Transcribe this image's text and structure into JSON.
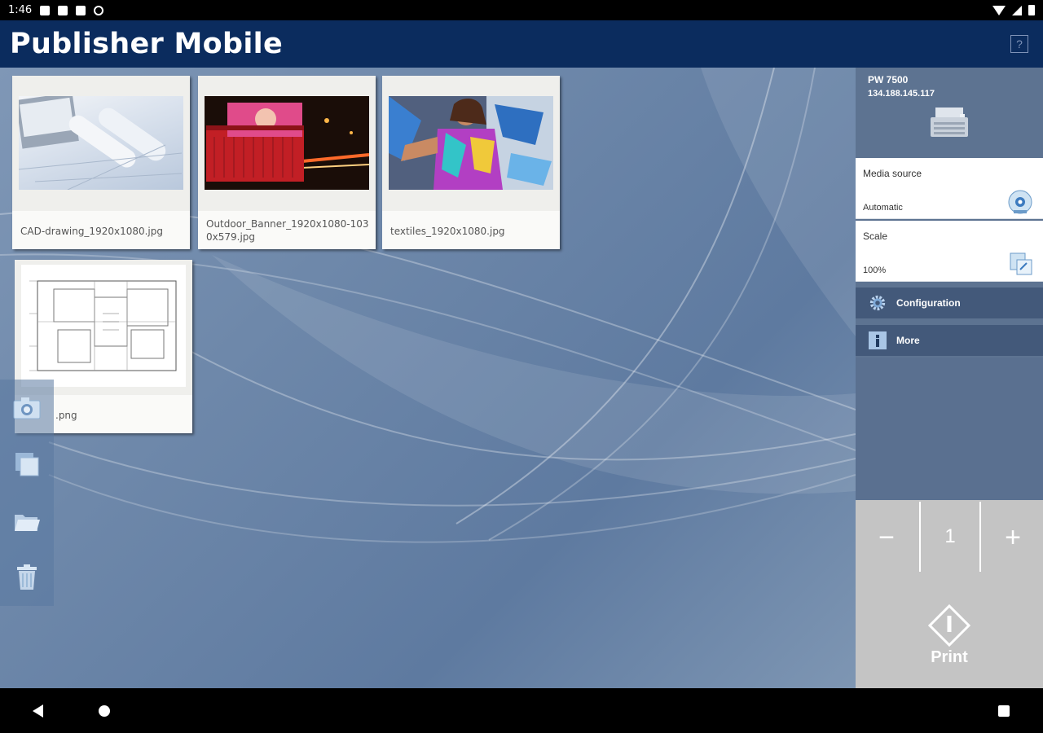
{
  "status_bar": {
    "time": "1:46",
    "icons": [
      "notification-icon",
      "mail-icon",
      "sd-card-icon",
      "settings-circle-icon",
      "wifi-icon",
      "signal-icon",
      "battery-icon"
    ]
  },
  "header": {
    "title": "Publisher Mobile",
    "help_label": "?"
  },
  "files": [
    {
      "name": "CAD-drawing_1920x1080.jpg"
    },
    {
      "name": "Outdoor_Banner_1920x1080-1030x579.jpg"
    },
    {
      "name": "textiles_1920x1080.jpg"
    },
    {
      "name": ".png"
    }
  ],
  "left_toolbar": {
    "icons": [
      "camera-icon",
      "gallery-icon",
      "folder-icon",
      "trash-icon"
    ]
  },
  "printer": {
    "name": "PW 7500",
    "ip": "134.188.145.117"
  },
  "settings": {
    "media_source": {
      "label": "Media source",
      "value": "Automatic"
    },
    "scale": {
      "label": "Scale",
      "value": "100%"
    }
  },
  "menu": {
    "configuration": "Configuration",
    "more": "More"
  },
  "copies": {
    "minus": "−",
    "count": "1",
    "plus": "+"
  },
  "print_label": "Print",
  "colors": {
    "header_bg": "#0b2c5e",
    "panel_bg": "#5d7391",
    "row_bg": "#43597a",
    "counter_bg": "#c4c4c4"
  }
}
